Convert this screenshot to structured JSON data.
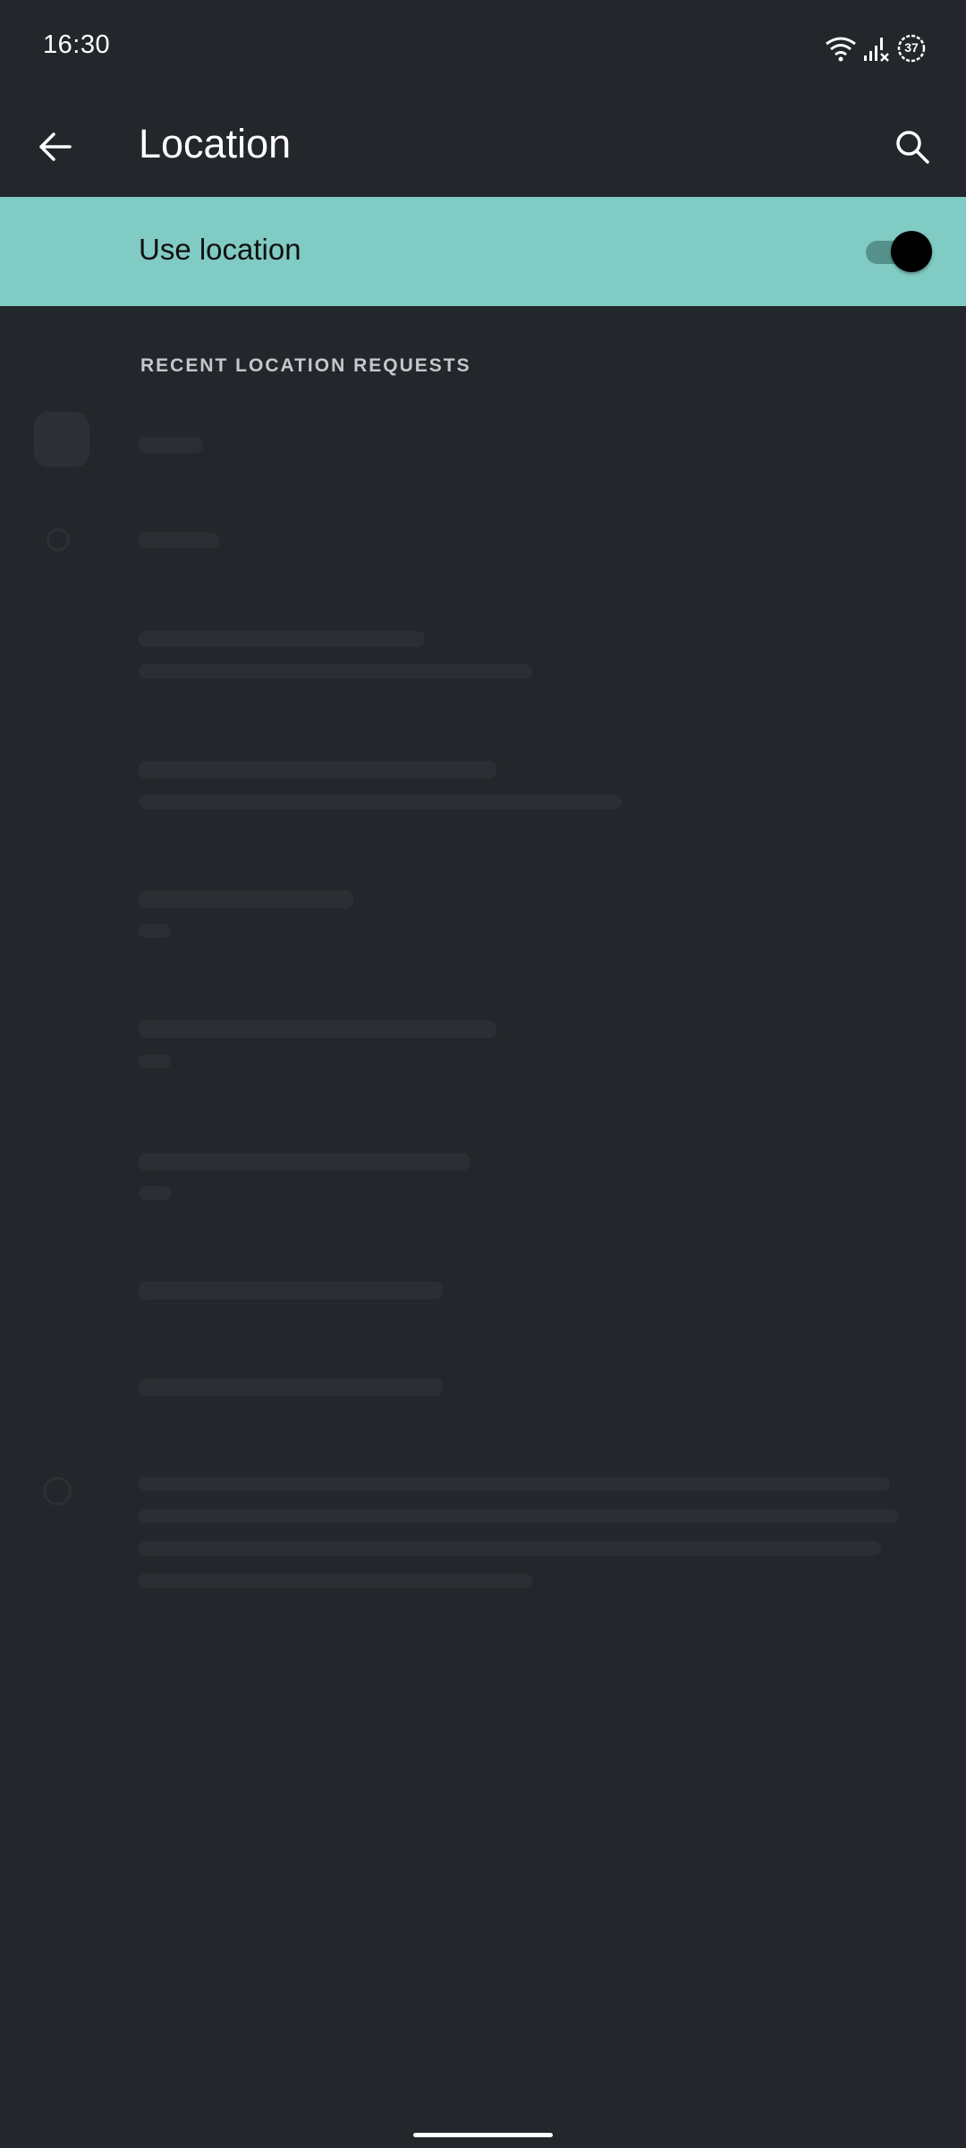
{
  "status_bar": {
    "time": "16:30",
    "battery_level": "37",
    "icons": [
      "wifi-icon",
      "signal-no-service-icon",
      "battery-icon"
    ]
  },
  "app_bar": {
    "title": "Location",
    "back_icon": "arrow-back-icon",
    "search_icon": "search-icon"
  },
  "main_toggle": {
    "label": "Use location",
    "state": "on",
    "background_color": "#80cbc4"
  },
  "section": {
    "header": "RECENT LOCATION REQUESTS"
  },
  "colors": {
    "background": "#23272b",
    "accent": "#80cbc4",
    "text_primary": "#ffffff",
    "section_header": "#c4c8cc"
  }
}
